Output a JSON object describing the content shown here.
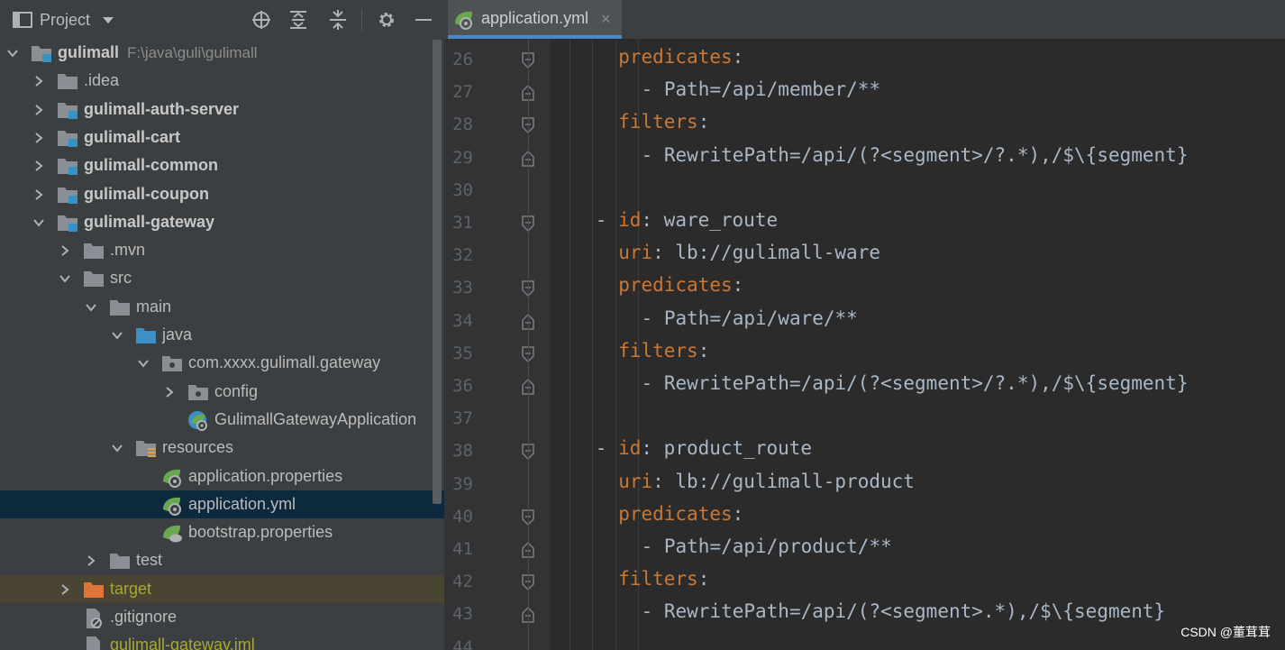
{
  "panel": {
    "title": "Project",
    "header_icons": [
      "locate-icon",
      "expand-all-icon",
      "collapse-all-icon",
      "gear-icon",
      "hide-icon"
    ]
  },
  "tree": [
    {
      "depth": 0,
      "label": "gulimall",
      "path": "F:\\java\\guli\\gulimall",
      "icon": "module-folder-icon",
      "bold": true,
      "expanded": true
    },
    {
      "depth": 1,
      "label": ".idea",
      "icon": "folder-icon",
      "expanded": false
    },
    {
      "depth": 1,
      "label": "gulimall-auth-server",
      "icon": "module-folder-icon",
      "bold": true,
      "expanded": false
    },
    {
      "depth": 1,
      "label": "gulimall-cart",
      "icon": "module-folder-icon",
      "bold": true,
      "expanded": false
    },
    {
      "depth": 1,
      "label": "gulimall-common",
      "icon": "module-folder-icon",
      "bold": true,
      "expanded": false
    },
    {
      "depth": 1,
      "label": "gulimall-coupon",
      "icon": "module-folder-icon",
      "bold": true,
      "expanded": false
    },
    {
      "depth": 1,
      "label": "gulimall-gateway",
      "icon": "module-folder-icon",
      "bold": true,
      "expanded": true
    },
    {
      "depth": 2,
      "label": ".mvn",
      "icon": "folder-icon",
      "expanded": false
    },
    {
      "depth": 2,
      "label": "src",
      "icon": "folder-icon",
      "expanded": true
    },
    {
      "depth": 3,
      "label": "main",
      "icon": "folder-icon",
      "expanded": true
    },
    {
      "depth": 4,
      "label": "java",
      "icon": "source-folder-icon",
      "expanded": true
    },
    {
      "depth": 5,
      "label": "com.xxxx.gulimall.gateway",
      "icon": "package-icon",
      "expanded": true
    },
    {
      "depth": 6,
      "label": "config",
      "icon": "package-icon",
      "expanded": false
    },
    {
      "depth": 6,
      "label": "GulimallGatewayApplication",
      "icon": "spring-boot-class-icon"
    },
    {
      "depth": 4,
      "label": "resources",
      "icon": "resources-folder-icon",
      "expanded": true
    },
    {
      "depth": 5,
      "label": "application.properties",
      "icon": "spring-config-icon"
    },
    {
      "depth": 5,
      "label": "application.yml",
      "icon": "spring-config-icon",
      "selected": true
    },
    {
      "depth": 5,
      "label": "bootstrap.properties",
      "icon": "spring-cloud-config-icon"
    },
    {
      "depth": 3,
      "label": "test",
      "icon": "folder-icon",
      "expanded": false
    },
    {
      "depth": 2,
      "label": "target",
      "icon": "excluded-folder-icon",
      "expanded": false,
      "excluded": true
    },
    {
      "depth": 2,
      "label": ".gitignore",
      "icon": "ignored-file-icon"
    },
    {
      "depth": 2,
      "label": "gulimall-gateway.iml",
      "icon": "iml-file-icon",
      "excluded": true
    }
  ],
  "editor": {
    "tab_label": "application.yml",
    "tab_close": "×",
    "lines": [
      {
        "n": "26",
        "indent": 6,
        "parts": [
          {
            "t": "predicates",
            "c": "k"
          },
          {
            "t": ":",
            "c": "p"
          }
        ],
        "fold": "start"
      },
      {
        "n": "27",
        "indent": 8,
        "parts": [
          {
            "t": "- Path=/api/member/**",
            "c": "v"
          }
        ],
        "fold": "end"
      },
      {
        "n": "28",
        "indent": 6,
        "parts": [
          {
            "t": "filters",
            "c": "k"
          },
          {
            "t": ":",
            "c": "p"
          }
        ],
        "fold": "start"
      },
      {
        "n": "29",
        "indent": 8,
        "parts": [
          {
            "t": "- RewritePath=/api/(?<segment>/?.*),/$\\{segment}",
            "c": "v"
          }
        ],
        "fold": "end"
      },
      {
        "n": "30",
        "indent": 0,
        "parts": [],
        "fold": ""
      },
      {
        "n": "31",
        "indent": 4,
        "parts": [
          {
            "t": "- ",
            "c": "p"
          },
          {
            "t": "id",
            "c": "k"
          },
          {
            "t": ": ware_route",
            "c": "v"
          }
        ],
        "fold": "start"
      },
      {
        "n": "32",
        "indent": 6,
        "parts": [
          {
            "t": "uri",
            "c": "k"
          },
          {
            "t": ": lb://gulimall-ware",
            "c": "v"
          }
        ],
        "fold": ""
      },
      {
        "n": "33",
        "indent": 6,
        "parts": [
          {
            "t": "predicates",
            "c": "k"
          },
          {
            "t": ":",
            "c": "p"
          }
        ],
        "fold": "start"
      },
      {
        "n": "34",
        "indent": 8,
        "parts": [
          {
            "t": "- Path=/api/ware/**",
            "c": "v"
          }
        ],
        "fold": "end"
      },
      {
        "n": "35",
        "indent": 6,
        "parts": [
          {
            "t": "filters",
            "c": "k"
          },
          {
            "t": ":",
            "c": "p"
          }
        ],
        "fold": "start"
      },
      {
        "n": "36",
        "indent": 8,
        "parts": [
          {
            "t": "- RewritePath=/api/(?<segment>/?.*),/$\\{segment}",
            "c": "v"
          }
        ],
        "fold": "end"
      },
      {
        "n": "37",
        "indent": 0,
        "parts": [],
        "fold": ""
      },
      {
        "n": "38",
        "indent": 4,
        "parts": [
          {
            "t": "- ",
            "c": "p"
          },
          {
            "t": "id",
            "c": "k"
          },
          {
            "t": ": product_route",
            "c": "v"
          }
        ],
        "fold": "start"
      },
      {
        "n": "39",
        "indent": 6,
        "parts": [
          {
            "t": "uri",
            "c": "k"
          },
          {
            "t": ": lb://gulimall-product",
            "c": "v"
          }
        ],
        "fold": ""
      },
      {
        "n": "40",
        "indent": 6,
        "parts": [
          {
            "t": "predicates",
            "c": "k"
          },
          {
            "t": ":",
            "c": "p"
          }
        ],
        "fold": "start"
      },
      {
        "n": "41",
        "indent": 8,
        "parts": [
          {
            "t": "- Path=/api/product/**",
            "c": "v"
          }
        ],
        "fold": "end"
      },
      {
        "n": "42",
        "indent": 6,
        "parts": [
          {
            "t": "filters",
            "c": "k"
          },
          {
            "t": ":",
            "c": "p"
          }
        ],
        "fold": "start"
      },
      {
        "n": "43",
        "indent": 8,
        "parts": [
          {
            "t": "- RewritePath=/api/(?<segment>.*),/$\\{segment}",
            "c": "v"
          }
        ],
        "fold": "end"
      },
      {
        "n": "44",
        "indent": 0,
        "parts": [],
        "fold": ""
      }
    ]
  },
  "watermark": "CSDN @董茸茸",
  "colors": {
    "panel_bg": "#3c3f41",
    "editor_bg": "#2b2b2b",
    "gutter_bg": "#313335",
    "selection": "#0d293e",
    "keyword": "#cc7832",
    "value": "#a9b7c6",
    "folder": "#8a8f96",
    "source_folder": "#3d8fc4",
    "module_marker": "#3592c4",
    "spring_green": "#6aa84f",
    "excluded_folder": "#e0733a"
  }
}
